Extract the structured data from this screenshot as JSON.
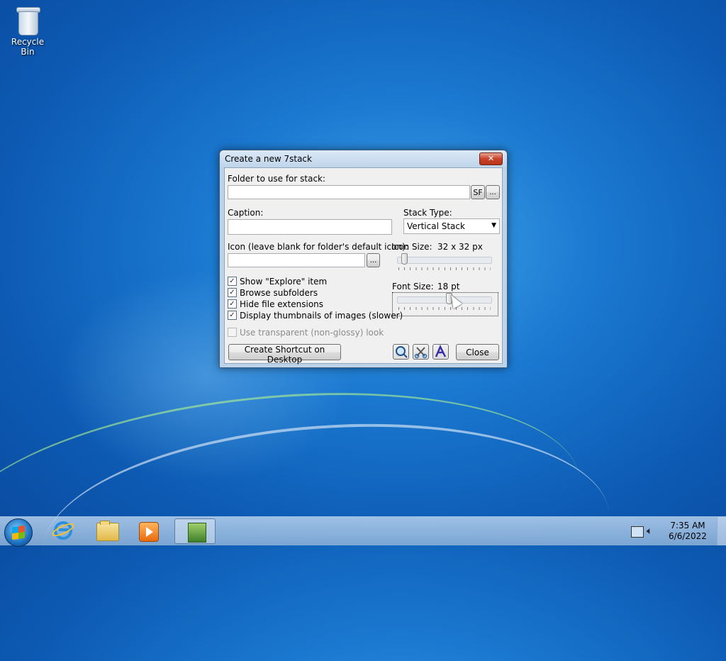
{
  "desktop": {
    "icons": [
      {
        "label": "Recycle Bin",
        "icon": "recycle-bin-icon"
      }
    ]
  },
  "dialog": {
    "title": "Create a new 7stack",
    "close_label": "✕",
    "folder_label": "Folder to use for stack:",
    "folder_value": "",
    "sf_button": "SF",
    "browse_button": "...",
    "caption_label": "Caption:",
    "caption_value": "",
    "stack_type_label": "Stack Type:",
    "stack_type_value": "Vertical Stack",
    "icon_label": "Icon (leave blank for folder's default icon):",
    "icon_value": "",
    "icon_browse_button": "...",
    "icon_size_label": "Icon Size:",
    "icon_size_value": "32 x 32 px",
    "icon_size_level": 0.05,
    "font_size_label": "Font Size:",
    "font_size_value": "18 pt",
    "font_size_level": 0.55,
    "checkboxes": [
      {
        "label": "Show \"Explore\" item",
        "checked": true
      },
      {
        "label": "Browse subfolders",
        "checked": true
      },
      {
        "label": "Hide file extensions",
        "checked": true
      },
      {
        "label": "Display thumbnails of images (slower)",
        "checked": true
      },
      {
        "label": "Use transparent (non-glossy) look",
        "checked": false,
        "disabled": true
      }
    ],
    "shortcut_button": "Create Shortcut on Desktop",
    "close_button": "Close",
    "tool_icons": [
      "search-icon",
      "tools-icon",
      "font-icon"
    ]
  },
  "taskbar": {
    "items": [
      "start-orb",
      "internet-explorer-icon",
      "windows-explorer-icon",
      "media-player-icon",
      "7stack-icon"
    ],
    "time": "7:35 AM",
    "date": "6/6/2022"
  }
}
